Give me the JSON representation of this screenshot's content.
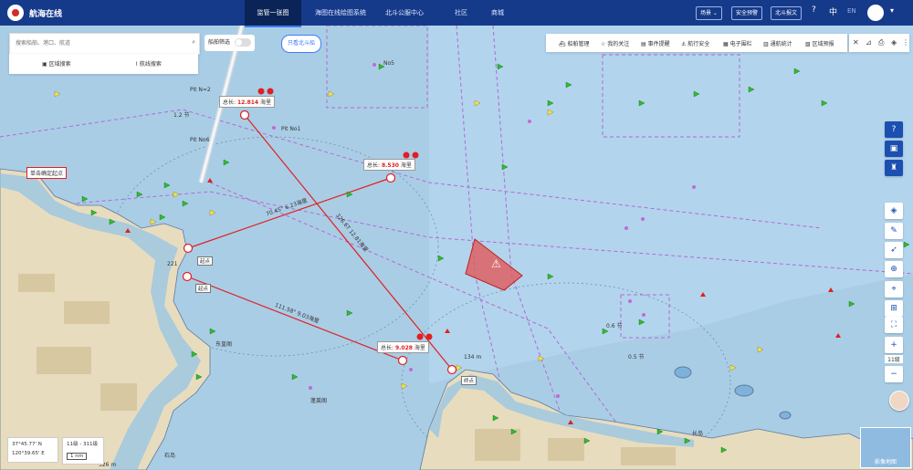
{
  "header": {
    "brand": "航海在线",
    "tabs": [
      "监管一张图",
      "海图在线绘图系统",
      "北斗公服中心",
      "社区",
      "商城"
    ],
    "active_tab": 0,
    "dropdown": "场景 ⌄",
    "btn1": "安全预警",
    "btn2": "北斗报文",
    "lang_zh": "中",
    "lang_en": "EN"
  },
  "search": {
    "placeholder": "搜索船舶、港口、航道",
    "icon": "search-icon",
    "shortcut1": "区域搜索",
    "shortcut2": "航线搜索"
  },
  "toggle": {
    "label": "船舶筛选",
    "state": "off"
  },
  "pill": {
    "label": "只看北斗船"
  },
  "toolbar": {
    "items": [
      "船舶管理",
      "我的关注",
      "事件提醒",
      "航行安全",
      "电子围栏",
      "通航统计",
      "区域预报"
    ]
  },
  "measurements": [
    {
      "label": "总长: ",
      "value": "12.814",
      "unit": " 海里"
    },
    {
      "label": "总长: ",
      "value": "8.530",
      "unit": " 海里"
    },
    {
      "label": "总长: ",
      "value": "9.028",
      "unit": " 海里"
    }
  ],
  "map_text": {
    "single_click_start": "单击确定起点",
    "bearing1": "70.45° 6.23海里",
    "bearing2": "326.6T 12.81海里",
    "bearing3": "111.58° 9.03海里",
    "area1": "No5",
    "area2": "Pit No1",
    "area3": "Pit No6",
    "area4": "Pit N=2",
    "pt1": "起点",
    "pt2": "起点",
    "pt3": "终点",
    "pt4": "终点",
    "place1": "东皇阁",
    "place2": "蓬莱阁",
    "place3": "石岛",
    "place4": "长岛",
    "depth1": "0.6 节",
    "depth2": "0.5 节",
    "depth3": "1.2 节",
    "depth4": "221",
    "depth5": "134 m",
    "depth6": "326 m"
  },
  "coords": {
    "lat": "37°45.77' N",
    "lon": "120°39.65' E"
  },
  "scale": {
    "level": "11级 - 311级",
    "bar": "1 nm"
  },
  "zoom_level": "11级",
  "minimap_label": "影像地图",
  "colors": {
    "header": "#163a8a",
    "sea": "#aacde6",
    "land": "#e8dcbf",
    "route": "#e02020",
    "accent": "#3d7cff"
  }
}
